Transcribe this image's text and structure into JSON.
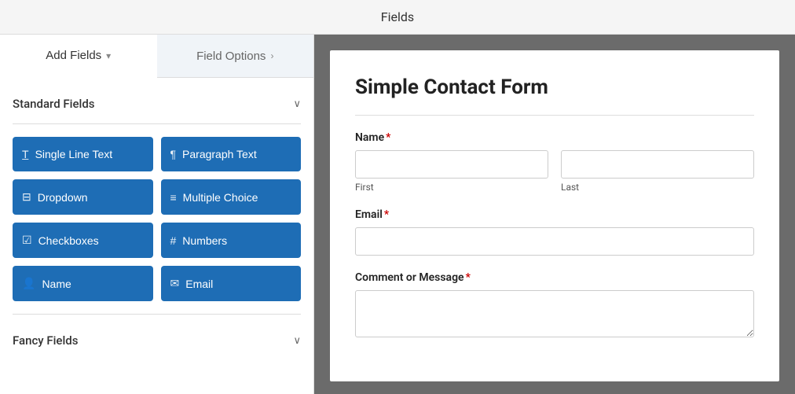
{
  "header": {
    "title": "Fields"
  },
  "tabs": [
    {
      "id": "add-fields",
      "label": "Add Fields",
      "active": true,
      "chevron": "▾"
    },
    {
      "id": "field-options",
      "label": "Field Options",
      "active": false,
      "chevron": "›"
    }
  ],
  "standard_fields": {
    "section_label": "Standard Fields",
    "chevron": "∨",
    "buttons": [
      {
        "id": "single-line-text",
        "icon": "T̲",
        "label": "Single Line Text"
      },
      {
        "id": "paragraph-text",
        "icon": "¶",
        "label": "Paragraph Text"
      },
      {
        "id": "dropdown",
        "icon": "⊟",
        "label": "Dropdown"
      },
      {
        "id": "multiple-choice",
        "icon": "≡",
        "label": "Multiple Choice"
      },
      {
        "id": "checkboxes",
        "icon": "☑",
        "label": "Checkboxes"
      },
      {
        "id": "numbers",
        "icon": "#",
        "label": "Numbers"
      },
      {
        "id": "name",
        "icon": "👤",
        "label": "Name"
      },
      {
        "id": "email",
        "icon": "✉",
        "label": "Email"
      }
    ]
  },
  "fancy_fields": {
    "section_label": "Fancy Fields",
    "chevron": "∨"
  },
  "form_preview": {
    "title": "Simple Contact Form",
    "fields": [
      {
        "id": "name",
        "label": "Name",
        "required": true,
        "type": "name",
        "sub_fields": [
          {
            "id": "first",
            "label": "First"
          },
          {
            "id": "last",
            "label": "Last"
          }
        ]
      },
      {
        "id": "email",
        "label": "Email",
        "required": true,
        "type": "email"
      },
      {
        "id": "comment",
        "label": "Comment or Message",
        "required": true,
        "type": "textarea"
      }
    ]
  }
}
